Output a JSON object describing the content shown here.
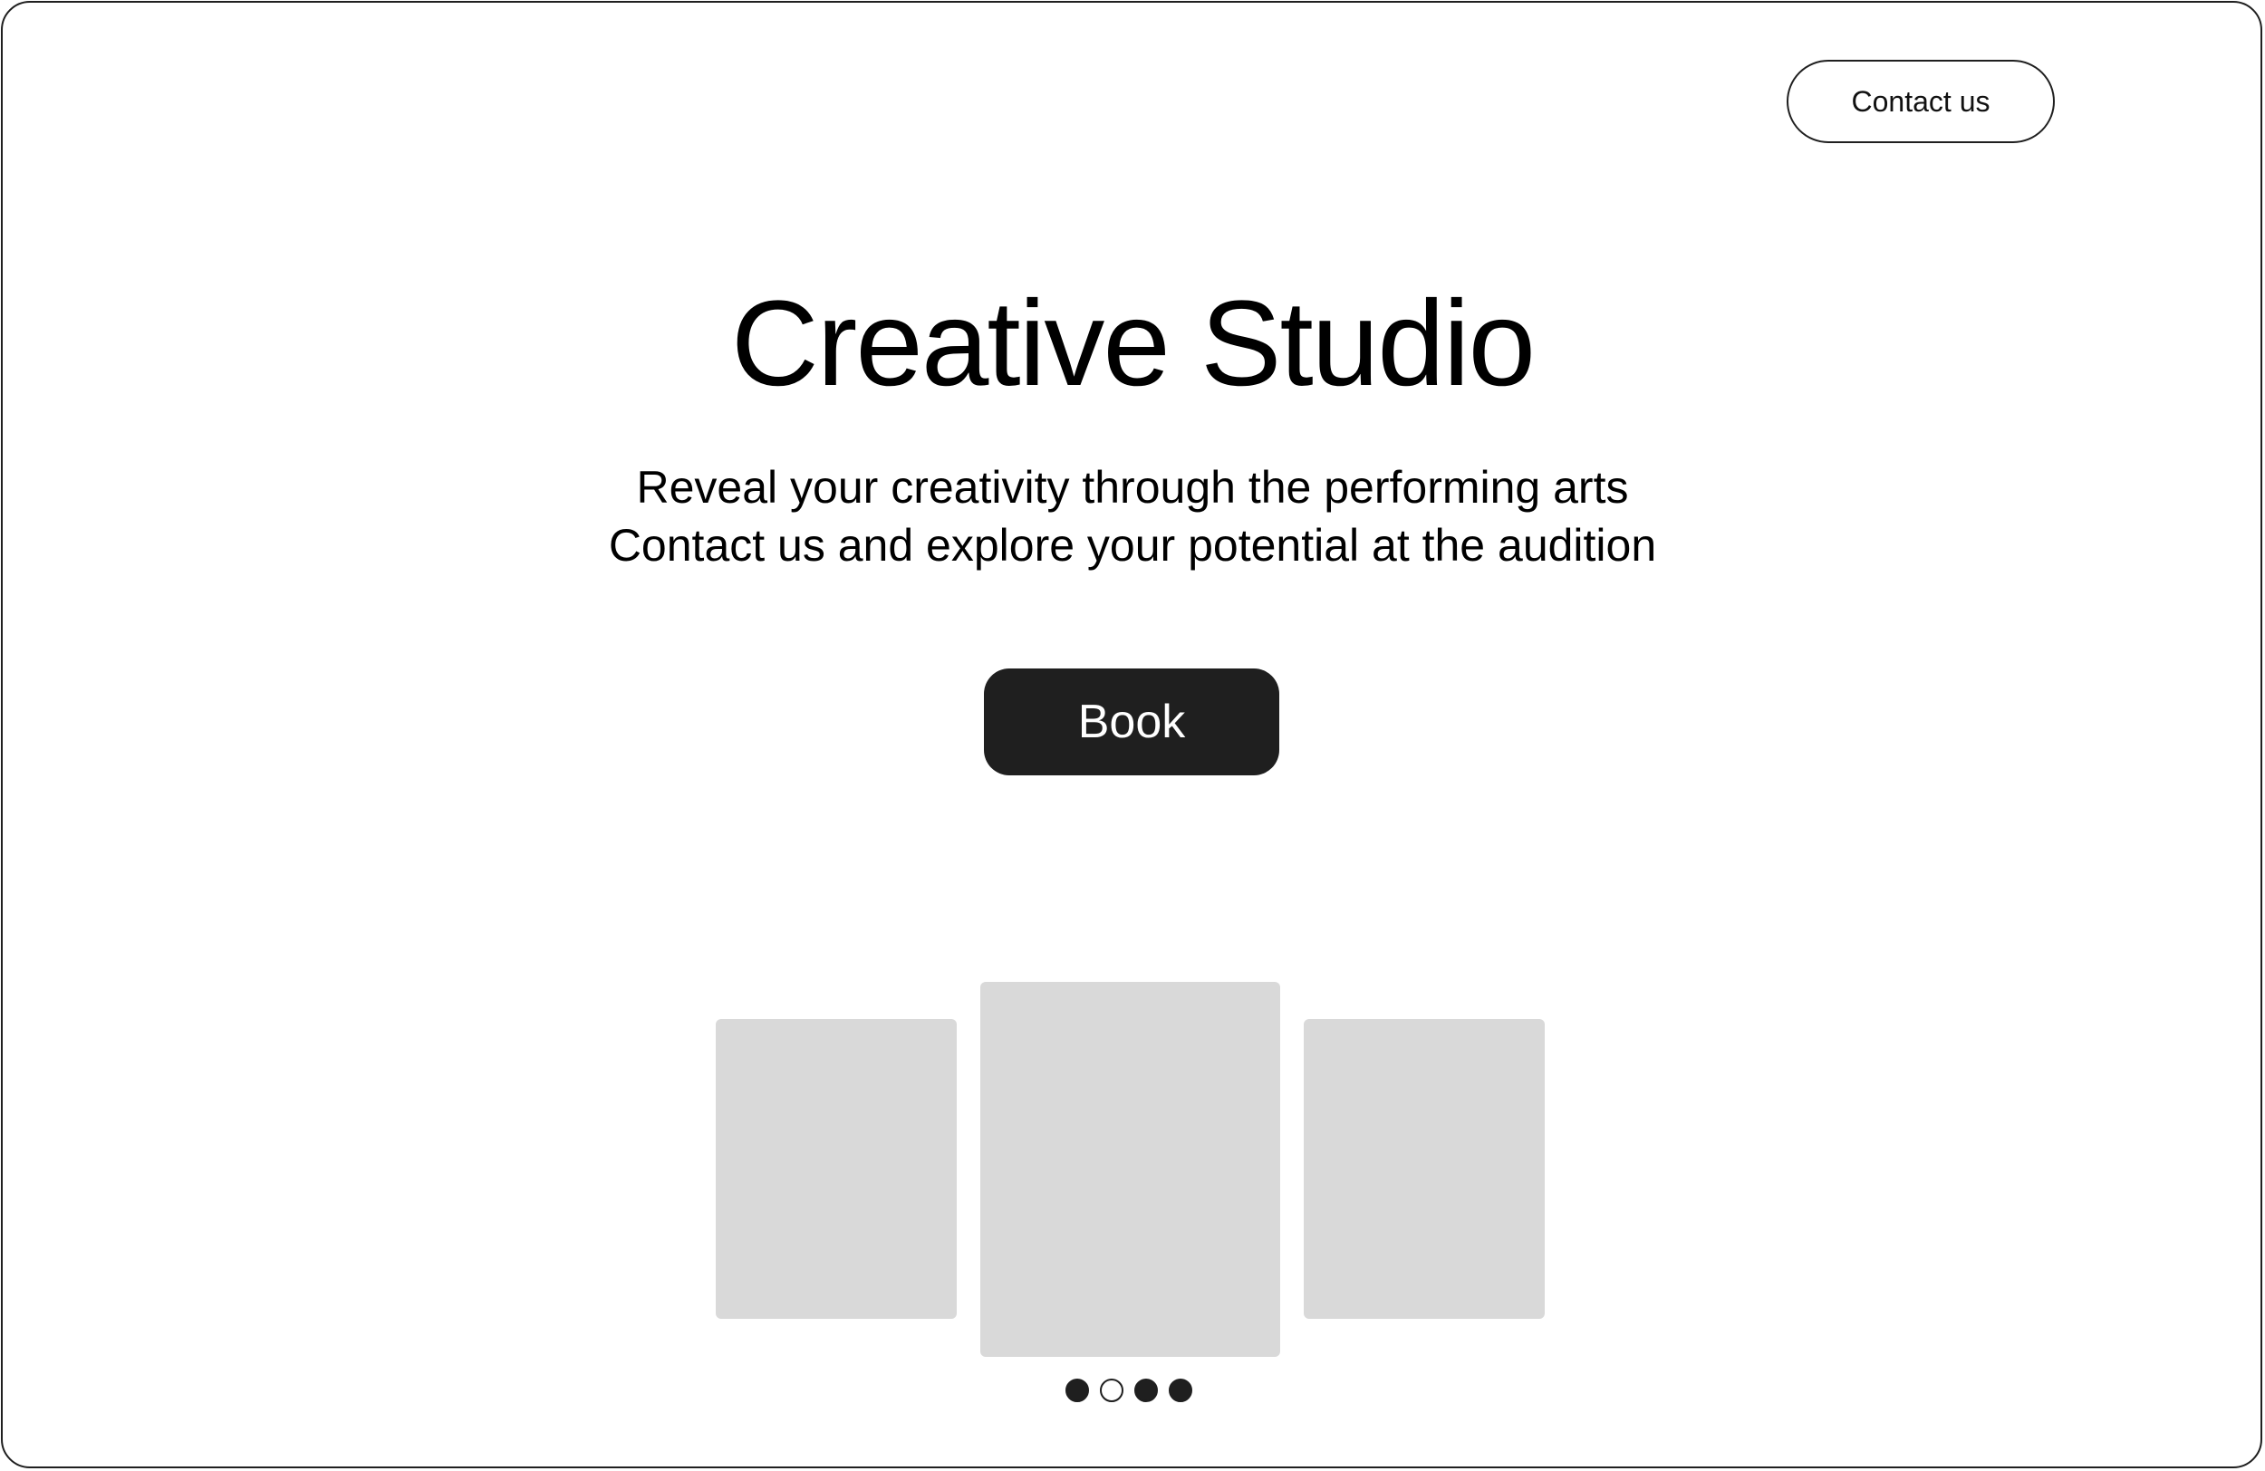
{
  "header": {
    "contact_label": "Contact us"
  },
  "hero": {
    "title": "Creative Studio",
    "subtitle_lines": [
      "Reveal your creativity through the performing arts",
      "Contact us and explore your potential at the audition"
    ],
    "cta_label": "Book"
  },
  "carousel": {
    "slide_count_visible": 3,
    "dots": [
      {
        "state": "filled"
      },
      {
        "state": "hollow"
      },
      {
        "state": "filled"
      },
      {
        "state": "filled"
      }
    ],
    "active_index": 1
  },
  "colors": {
    "primary": "#1f1f1f",
    "placeholder": "#d9d9d9",
    "background": "#ffffff"
  }
}
